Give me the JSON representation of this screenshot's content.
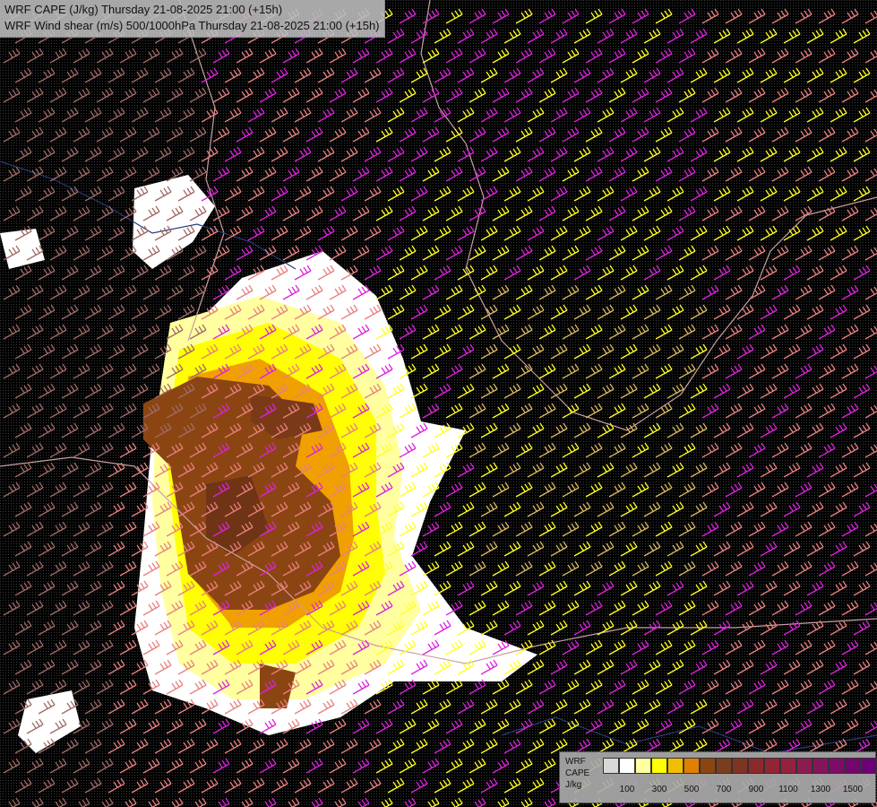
{
  "header": {
    "line1": "WRF CAPE (J/kg) Thursday 21-08-2025 21:00 (+15h)",
    "line2": "WRF Wind shear (m/s) 500/1000hPa Thursday 21-08-2025 21:00 (+15h)"
  },
  "legend": {
    "model": "WRF",
    "field": "CAPE",
    "unit": "J/kg",
    "colors": [
      "#d8d8d8",
      "#ffffff",
      "#ffffa0",
      "#ffff00",
      "#f0c000",
      "#e08000",
      "#8b4513",
      "#7a3e1e",
      "#7f3322",
      "#8a2a2a",
      "#922436",
      "#962040",
      "#8c1c50",
      "#84145c",
      "#7c0c66",
      "#74046e",
      "#6c0074"
    ],
    "tick_labels": [
      "100",
      "300",
      "500",
      "700",
      "900",
      "1100",
      "1300",
      "1500"
    ]
  },
  "map_colors": {
    "background": "#000000",
    "shear_low": "#a06a66",
    "shear_mid": "#e88080",
    "shear_high": "#dd22dd",
    "shear_very_high": "#ffff22",
    "shear_extreme": "#d8b860",
    "borders": "#caa0a0",
    "coast": "#2a3c7a"
  }
}
